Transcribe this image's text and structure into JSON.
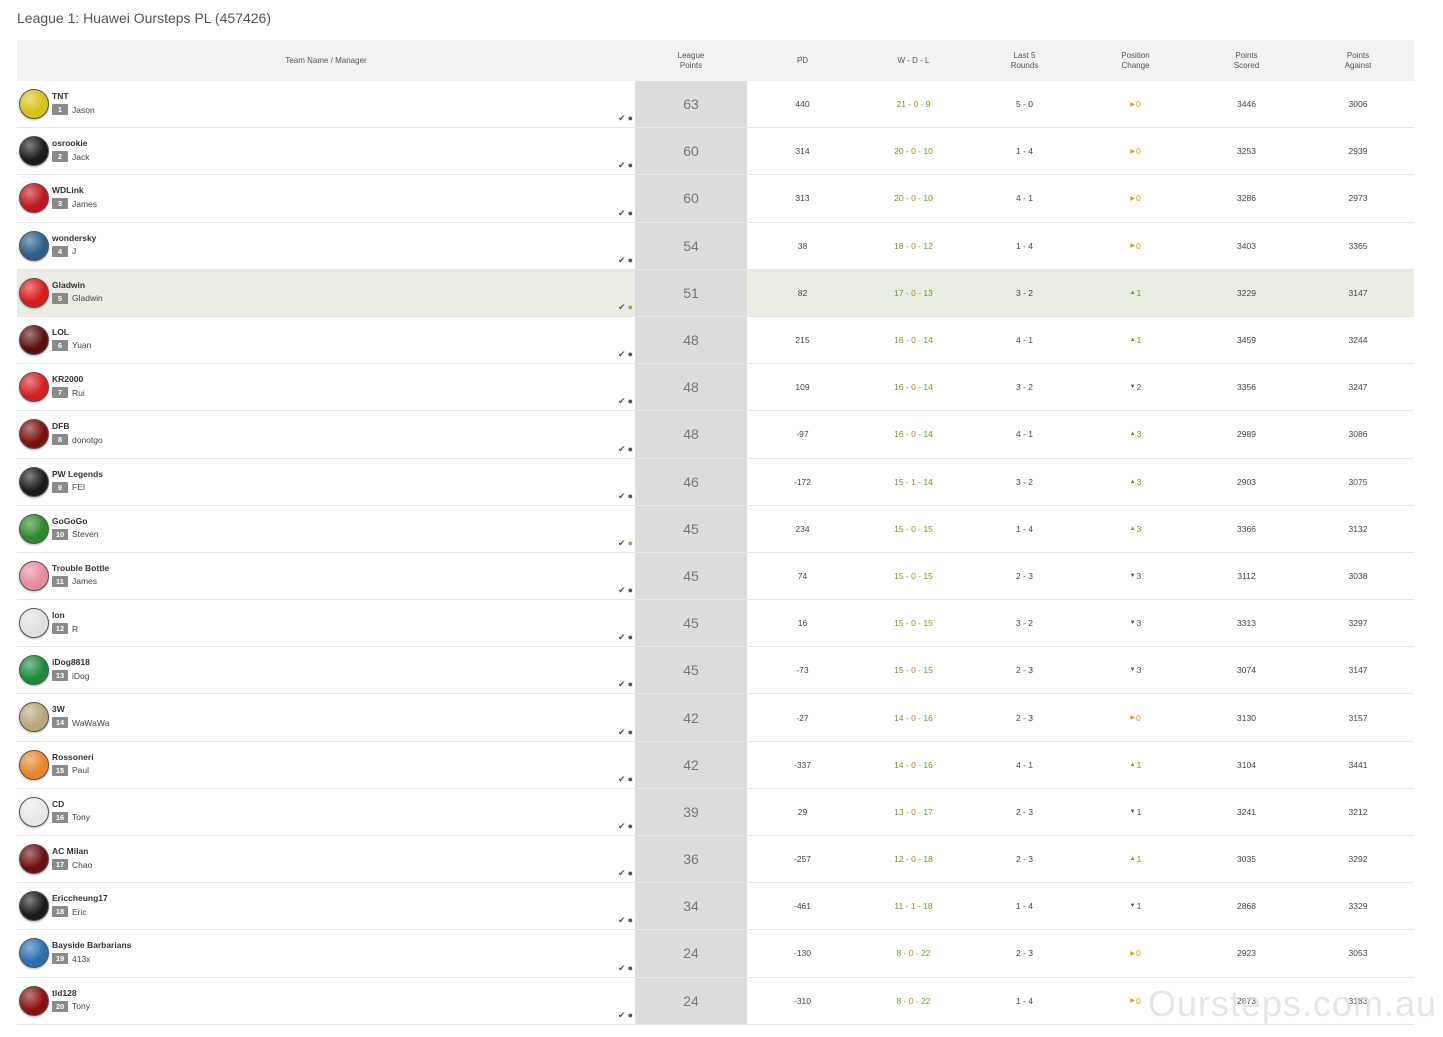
{
  "title": "League 1: Huawei Oursteps PL (457426)",
  "headers": {
    "team": "Team Name / Manager",
    "lp1": "League",
    "lp2": "Points",
    "pd": "PD",
    "wdl": "W - D - L",
    "l5a": "Last 5",
    "l5b": "Rounds",
    "pca": "Position",
    "pcb": "Change",
    "psa": "Points",
    "psb": "Scored",
    "paa": "Points",
    "pab": "Against"
  },
  "rows": [
    {
      "team": "TNT",
      "rank": "1",
      "manager": "Jason",
      "lp": "63",
      "pd": "440",
      "w": "21",
      "d": "0",
      "l": "9",
      "l5": "5 - 0",
      "pc": "0",
      "pcdir": "same",
      "ps": "3446",
      "pa": "3006",
      "badge": "#d4c21a"
    },
    {
      "team": "osrookie",
      "rank": "2",
      "manager": "Jack",
      "lp": "60",
      "pd": "314",
      "w": "20",
      "d": "0",
      "l": "10",
      "l5": "1 - 4",
      "pc": "0",
      "pcdir": "same",
      "ps": "3253",
      "pa": "2939",
      "badge": "#1a1a1a"
    },
    {
      "team": "WDLink",
      "rank": "3",
      "manager": "James",
      "lp": "60",
      "pd": "313",
      "w": "20",
      "d": "0",
      "l": "10",
      "l5": "4 - 1",
      "pc": "0",
      "pcdir": "same",
      "ps": "3286",
      "pa": "2973",
      "badge": "#c0161c"
    },
    {
      "team": "wondersky",
      "rank": "4",
      "manager": "J",
      "lp": "54",
      "pd": "38",
      "w": "18",
      "d": "0",
      "l": "12",
      "l5": "1 - 4",
      "pc": "0",
      "pcdir": "same",
      "ps": "3403",
      "pa": "3365",
      "badge": "#2b5f8a"
    },
    {
      "team": "Gladwin",
      "rank": "5",
      "manager": "Gladwin",
      "lp": "51",
      "pd": "82",
      "w": "17",
      "d": "0",
      "l": "13",
      "l5": "3 - 2",
      "pc": "1",
      "pcdir": "up",
      "ps": "3229",
      "pa": "3147",
      "badge": "#d81c1c",
      "highlight": "true",
      "green": "true"
    },
    {
      "team": "LOL",
      "rank": "6",
      "manager": "Yuan",
      "lp": "48",
      "pd": "215",
      "w": "16",
      "d": "0",
      "l": "14",
      "l5": "4 - 1",
      "pc": "1",
      "pcdir": "up",
      "ps": "3459",
      "pa": "3244",
      "badge": "#5a1010"
    },
    {
      "team": "KR2000",
      "rank": "7",
      "manager": "Rui",
      "lp": "48",
      "pd": "109",
      "w": "16",
      "d": "0",
      "l": "14",
      "l5": "3 - 2",
      "pc": "2",
      "pcdir": "down",
      "ps": "3356",
      "pa": "3247",
      "badge": "#d42020"
    },
    {
      "team": "DFB",
      "rank": "8",
      "manager": "donotgo",
      "lp": "48",
      "pd": "-97",
      "w": "16",
      "d": "0",
      "l": "14",
      "l5": "4 - 1",
      "pc": "3",
      "pcdir": "up",
      "ps": "2989",
      "pa": "3086",
      "badge": "#7a1010"
    },
    {
      "team": "PW Legends",
      "rank": "9",
      "manager": "FEI",
      "lp": "46",
      "pd": "-172",
      "w": "15",
      "d": "1",
      "l": "14",
      "l5": "3 - 2",
      "pc": "3",
      "pcdir": "up",
      "ps": "2903",
      "pa": "3075",
      "badge": "#1a1a1a"
    },
    {
      "team": "GoGoGo",
      "rank": "10",
      "manager": "Steven",
      "lp": "45",
      "pd": "234",
      "w": "15",
      "d": "0",
      "l": "15",
      "l5": "1 - 4",
      "pc": "3",
      "pcdir": "up",
      "ps": "3366",
      "pa": "3132",
      "badge": "#2c8a2c",
      "green": "true"
    },
    {
      "team": "Trouble Bottle",
      "rank": "11",
      "manager": "James",
      "lp": "45",
      "pd": "74",
      "w": "15",
      "d": "0",
      "l": "15",
      "l5": "2 - 3",
      "pc": "3",
      "pcdir": "down",
      "ps": "3112",
      "pa": "3038",
      "badge": "#e88aa0"
    },
    {
      "team": "lon",
      "rank": "12",
      "manager": "R",
      "lp": "45",
      "pd": "16",
      "w": "15",
      "d": "0",
      "l": "15",
      "l5": "3 - 2",
      "pc": "3",
      "pcdir": "down",
      "ps": "3313",
      "pa": "3297",
      "badge": "#e0e0e0"
    },
    {
      "team": "iDog8818",
      "rank": "13",
      "manager": "iDog",
      "lp": "45",
      "pd": "-73",
      "w": "15",
      "d": "0",
      "l": "15",
      "l5": "2 - 3",
      "pc": "3",
      "pcdir": "down",
      "ps": "3074",
      "pa": "3147",
      "badge": "#1a8a3a"
    },
    {
      "team": "3W",
      "rank": "14",
      "manager": "WaWaWa",
      "lp": "42",
      "pd": "-27",
      "w": "14",
      "d": "0",
      "l": "16",
      "l5": "2 - 3",
      "pc": "0",
      "pcdir": "same",
      "ps": "3130",
      "pa": "3157",
      "badge": "#b8a77a"
    },
    {
      "team": "Rossoneri",
      "rank": "15",
      "manager": "Paul",
      "lp": "42",
      "pd": "-337",
      "w": "14",
      "d": "0",
      "l": "16",
      "l5": "4 - 1",
      "pc": "1",
      "pcdir": "up",
      "ps": "3104",
      "pa": "3441",
      "badge": "#e8862a"
    },
    {
      "team": "CD",
      "rank": "16",
      "manager": "Tony",
      "lp": "39",
      "pd": "29",
      "w": "13",
      "d": "0",
      "l": "17",
      "l5": "2 - 3",
      "pc": "1",
      "pcdir": "down",
      "ps": "3241",
      "pa": "3212",
      "badge": "#e8e8e8"
    },
    {
      "team": "AC Milan",
      "rank": "17",
      "manager": "Chao",
      "lp": "36",
      "pd": "-257",
      "w": "12",
      "d": "0",
      "l": "18",
      "l5": "2 - 3",
      "pc": "1",
      "pcdir": "up",
      "ps": "3035",
      "pa": "3292",
      "badge": "#6a1010"
    },
    {
      "team": "Ericcheung17",
      "rank": "18",
      "manager": "Eric",
      "lp": "34",
      "pd": "-461",
      "w": "11",
      "d": "1",
      "l": "18",
      "l5": "1 - 4",
      "pc": "1",
      "pcdir": "down",
      "ps": "2868",
      "pa": "3329",
      "badge": "#1a1a1a"
    },
    {
      "team": "Bayside Barbarians",
      "rank": "19",
      "manager": "413x",
      "lp": "24",
      "pd": "-130",
      "w": "8",
      "d": "0",
      "l": "22",
      "l5": "2 - 3",
      "pc": "0",
      "pcdir": "same",
      "ps": "2923",
      "pa": "3053",
      "badge": "#2a6fb0"
    },
    {
      "team": "tld128",
      "rank": "20",
      "manager": "Tony",
      "lp": "24",
      "pd": "-310",
      "w": "8",
      "d": "0",
      "l": "22",
      "l5": "1 - 4",
      "pc": "0",
      "pcdir": "same",
      "ps": "2873",
      "pa": "3183",
      "badge": "#8a1010"
    }
  ],
  "watermark": "Oursteps.com.au",
  "icons": {
    "check": "check-icon",
    "user": "user-icon",
    "up": "triangle-up-icon",
    "down": "triangle-down-icon",
    "same": "triangle-right-icon"
  }
}
